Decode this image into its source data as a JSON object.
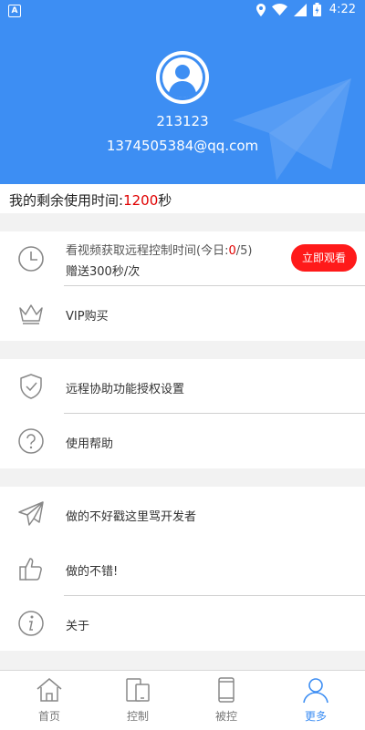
{
  "status_bar": {
    "time": "4:22"
  },
  "profile": {
    "username": "213123",
    "email": "1374505384@qq.com"
  },
  "remaining": {
    "label": "我的剩余使用时间:",
    "value": "1200",
    "unit": "秒"
  },
  "watch_video": {
    "label_prefix": "看视频获取远程控制时间(今日:",
    "count_current": "0",
    "count_suffix": "/5)",
    "reward": "赠送300秒/次",
    "button": "立即观看"
  },
  "menu": {
    "vip": "VIP购买",
    "remote_auth": "远程协助功能授权设置",
    "help": "使用帮助",
    "complain": "做的不好戳这里骂开发者",
    "praise": "做的不错!",
    "about": "关于"
  },
  "bottom_nav": [
    {
      "label": "首页"
    },
    {
      "label": "控制"
    },
    {
      "label": "被控"
    },
    {
      "label": "更多"
    }
  ],
  "colors": {
    "primary": "#3d8ef3",
    "accent_red": "#e00000",
    "button_red": "#ff1a1a"
  }
}
